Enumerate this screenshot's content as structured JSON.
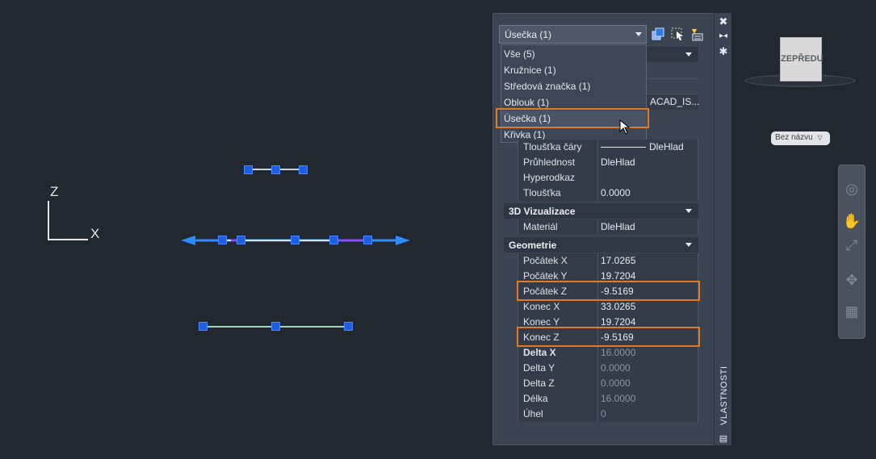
{
  "viewport": {
    "ucs": {
      "z_label": "Z",
      "x_label": "X"
    }
  },
  "palette": {
    "title": "VLASTNOSTI",
    "selection": "Úsečka (1)",
    "dropdown_items": [
      {
        "label": "Vše (5)"
      },
      {
        "label": "Kružnice (1)"
      },
      {
        "label": "Středová značka (1)"
      },
      {
        "label": "Oblouk (1)"
      },
      {
        "label": "Úsečka (1)"
      },
      {
        "label": "Křivka (1)"
      }
    ],
    "partial_value": "ACAD_IS...",
    "general_rows": [
      {
        "name": "Tloušťka čáry",
        "value": "DleHlad"
      },
      {
        "name": "Průhlednost",
        "value": "DleHlad"
      },
      {
        "name": "Hyperodkaz",
        "value": ""
      },
      {
        "name": "Tloušťka",
        "value": "0.0000"
      }
    ],
    "cat_visual": "3D Vizualizace",
    "visual_rows": [
      {
        "name": "Materiál",
        "value": "DleHlad"
      }
    ],
    "cat_geometry": "Geometrie",
    "geometry_rows": [
      {
        "name": "Počátek X",
        "value": "17.0265"
      },
      {
        "name": "Počátek Y",
        "value": "19.7204"
      },
      {
        "name": "Počátek Z",
        "value": "-9.5169"
      },
      {
        "name": "Konec X",
        "value": "33.0265"
      },
      {
        "name": "Konec Y",
        "value": "19.7204"
      },
      {
        "name": "Konec Z",
        "value": "-9.5169"
      },
      {
        "name": "Delta X",
        "value": "16.0000"
      },
      {
        "name": "Delta Y",
        "value": "0.0000"
      },
      {
        "name": "Delta Z",
        "value": "0.0000"
      },
      {
        "name": "Délka",
        "value": "16.0000"
      },
      {
        "name": "Úhel",
        "value": "0"
      }
    ]
  },
  "viewcube": {
    "face": "ZEPŘEDU",
    "named_view": "Bez názvu"
  },
  "colors": {
    "highlight": "#e07b24",
    "grip": "#1d5fe0",
    "background": "#212830"
  }
}
